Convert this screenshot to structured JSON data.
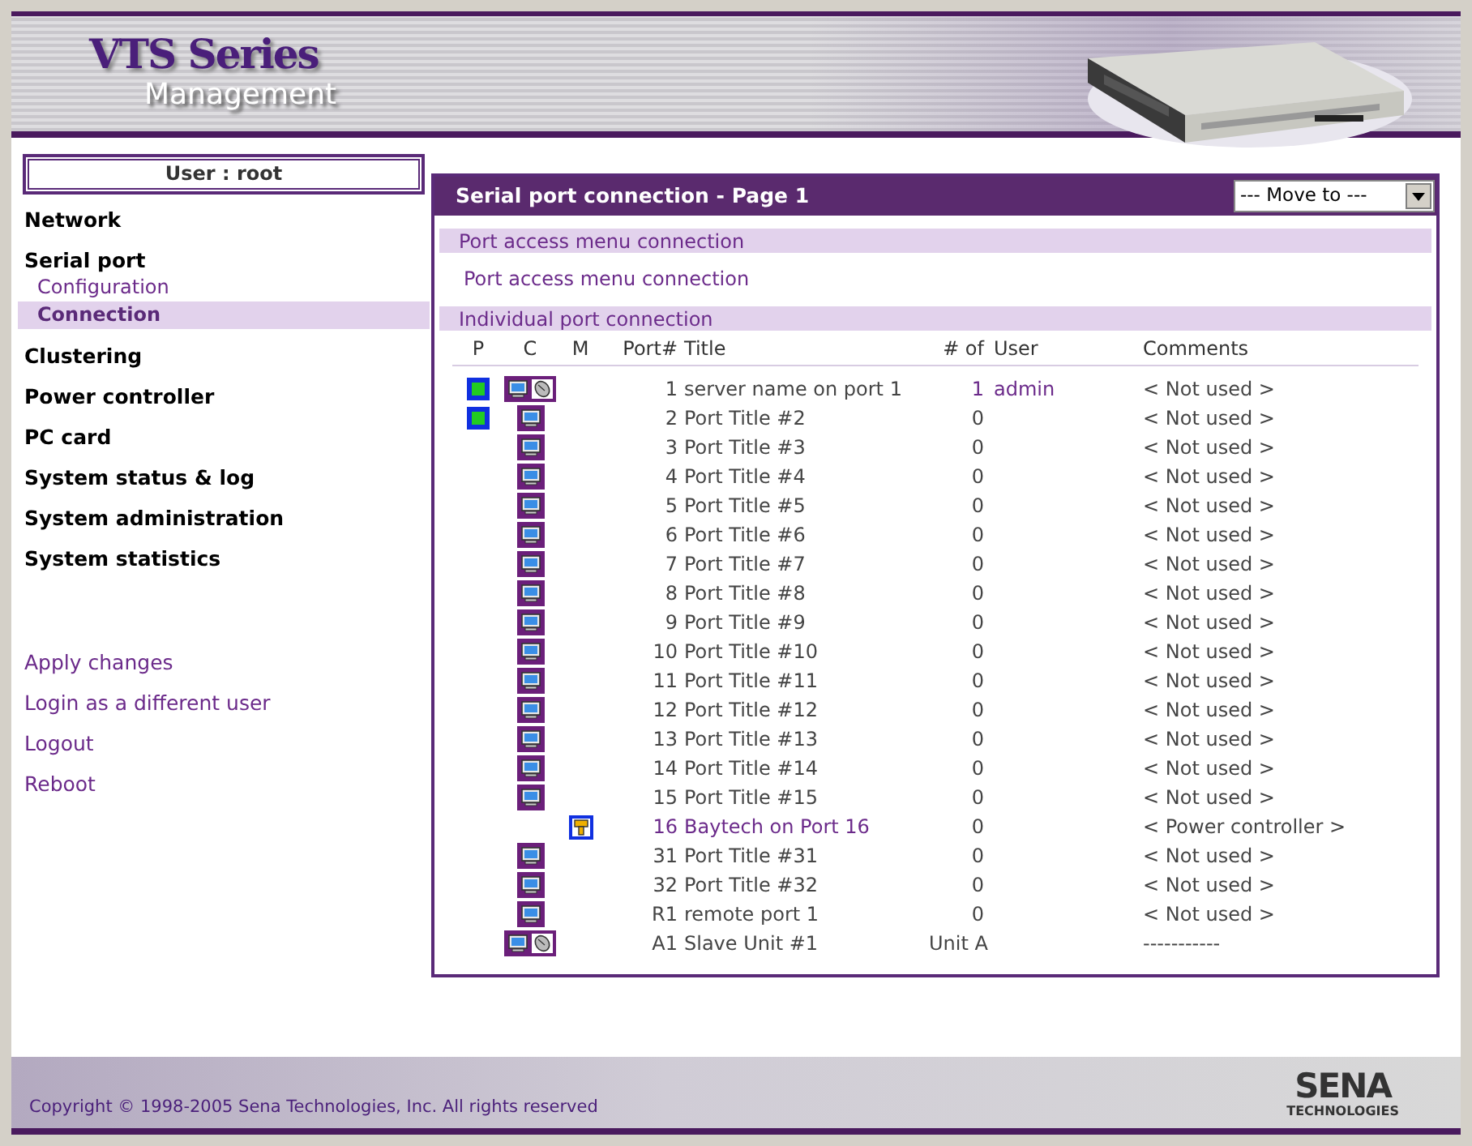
{
  "header": {
    "title": "VTS Series",
    "subtitle": "Management"
  },
  "sidebar": {
    "user": "User : root",
    "items": [
      {
        "label": "Network",
        "selected": false
      },
      {
        "label": "Serial port",
        "selected": false,
        "children": [
          {
            "label": "Configuration",
            "selected": false
          },
          {
            "label": "Connection",
            "selected": true
          }
        ]
      },
      {
        "label": "Clustering",
        "selected": false
      },
      {
        "label": "Power controller",
        "selected": false
      },
      {
        "label": "PC card",
        "selected": false
      },
      {
        "label": "System status & log",
        "selected": false
      },
      {
        "label": "System administration",
        "selected": false
      },
      {
        "label": "System statistics",
        "selected": false
      }
    ],
    "links": [
      "Apply changes",
      "Login as a different user",
      "Logout",
      "Reboot"
    ]
  },
  "panel": {
    "title": "Serial port connection - Page 1",
    "move_to": "--- Move to ---",
    "sections": [
      {
        "title": "Port access menu connection",
        "link": "Port access menu connection"
      },
      {
        "title": "Individual port connection"
      }
    ],
    "table": {
      "columns": [
        "P",
        "C",
        "M",
        "Port#",
        "Title",
        "# of",
        "User",
        "Comments"
      ],
      "rows": [
        {
          "powered": true,
          "console": true,
          "mouse": true,
          "power_switch": false,
          "port": "1",
          "title": "server name on port 1",
          "count": "1",
          "user": "admin",
          "comment": "< Not used >",
          "active": true,
          "highlight": false
        },
        {
          "powered": true,
          "console": true,
          "mouse": false,
          "power_switch": false,
          "port": "2",
          "title": "Port Title #2",
          "count": "0",
          "comment": "< Not used >",
          "active": false,
          "highlight": false
        },
        {
          "powered": false,
          "console": true,
          "mouse": false,
          "power_switch": false,
          "port": "3",
          "title": "Port Title #3",
          "count": "0",
          "comment": "< Not used >",
          "active": false,
          "highlight": false
        },
        {
          "powered": false,
          "console": true,
          "mouse": false,
          "power_switch": false,
          "port": "4",
          "title": "Port Title #4",
          "count": "0",
          "comment": "< Not used >",
          "active": false,
          "highlight": false
        },
        {
          "powered": false,
          "console": true,
          "mouse": false,
          "power_switch": false,
          "port": "5",
          "title": "Port Title #5",
          "count": "0",
          "comment": "< Not used >",
          "active": false,
          "highlight": false
        },
        {
          "powered": false,
          "console": true,
          "mouse": false,
          "power_switch": false,
          "port": "6",
          "title": "Port Title #6",
          "count": "0",
          "comment": "< Not used >",
          "active": false,
          "highlight": false
        },
        {
          "powered": false,
          "console": true,
          "mouse": false,
          "power_switch": false,
          "port": "7",
          "title": "Port Title #7",
          "count": "0",
          "comment": "< Not used >",
          "active": false,
          "highlight": false
        },
        {
          "powered": false,
          "console": true,
          "mouse": false,
          "power_switch": false,
          "port": "8",
          "title": "Port Title #8",
          "count": "0",
          "comment": "< Not used >",
          "active": false,
          "highlight": false
        },
        {
          "powered": false,
          "console": true,
          "mouse": false,
          "power_switch": false,
          "port": "9",
          "title": "Port Title #9",
          "count": "0",
          "comment": "< Not used >",
          "active": false,
          "highlight": false
        },
        {
          "powered": false,
          "console": true,
          "mouse": false,
          "power_switch": false,
          "port": "10",
          "title": "Port Title #10",
          "count": "0",
          "comment": "< Not used >",
          "active": false,
          "highlight": false
        },
        {
          "powered": false,
          "console": true,
          "mouse": false,
          "power_switch": false,
          "port": "11",
          "title": "Port Title #11",
          "count": "0",
          "comment": "< Not used >",
          "active": false,
          "highlight": false
        },
        {
          "powered": false,
          "console": true,
          "mouse": false,
          "power_switch": false,
          "port": "12",
          "title": "Port Title #12",
          "count": "0",
          "comment": "< Not used >",
          "active": false,
          "highlight": false
        },
        {
          "powered": false,
          "console": true,
          "mouse": false,
          "power_switch": false,
          "port": "13",
          "title": "Port Title #13",
          "count": "0",
          "comment": "< Not used >",
          "active": false,
          "highlight": false
        },
        {
          "powered": false,
          "console": true,
          "mouse": false,
          "power_switch": false,
          "port": "14",
          "title": "Port Title #14",
          "count": "0",
          "comment": "< Not used >",
          "active": false,
          "highlight": false
        },
        {
          "powered": false,
          "console": true,
          "mouse": false,
          "power_switch": false,
          "port": "15",
          "title": "Port Title #15",
          "count": "0",
          "comment": "< Not used >",
          "active": false,
          "highlight": false
        },
        {
          "powered": false,
          "console": false,
          "mouse": false,
          "power_switch": true,
          "port": "16",
          "title": "Baytech on Port 16",
          "count": "0",
          "comment": "< Power controller >",
          "active": false,
          "highlight": true
        },
        {
          "powered": false,
          "console": true,
          "mouse": false,
          "power_switch": false,
          "port": "31",
          "title": "Port Title #31",
          "count": "0",
          "comment": "< Not used >",
          "active": false,
          "highlight": false
        },
        {
          "powered": false,
          "console": true,
          "mouse": false,
          "power_switch": false,
          "port": "32",
          "title": "Port Title #32",
          "count": "0",
          "comment": "< Not used >",
          "active": false,
          "highlight": false
        },
        {
          "powered": false,
          "console": true,
          "mouse": false,
          "power_switch": false,
          "port": "R1",
          "title": "remote port 1",
          "count": "0",
          "comment": "< Not used >",
          "active": false,
          "highlight": false
        },
        {
          "powered": false,
          "console": true,
          "mouse": true,
          "power_switch": false,
          "port": "A1",
          "title": "Slave Unit #1",
          "count": "Unit A",
          "comment": "-----------",
          "active": false,
          "highlight": false
        }
      ]
    }
  },
  "footer": {
    "copyright": "Copyright © 1998-2005 Sena Technologies, Inc. All rights reserved",
    "logo": "SENA",
    "logo_sub": "TECHNOLOGIES"
  }
}
